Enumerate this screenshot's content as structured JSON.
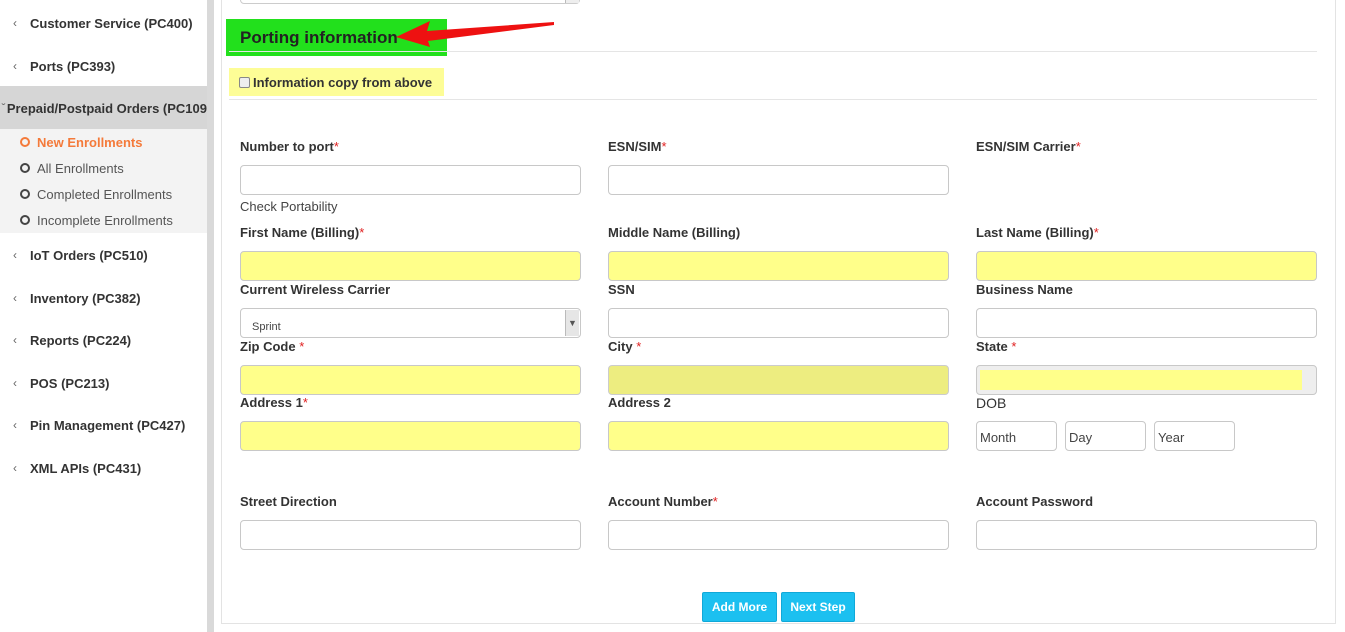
{
  "sidebar": {
    "items": [
      {
        "label": "Customer Service (PC400)"
      },
      {
        "label": "Ports (PC393)"
      },
      {
        "label": "Prepaid/Postpaid Orders (PC109"
      },
      {
        "label": "IoT Orders (PC510)"
      },
      {
        "label": "Inventory (PC382)"
      },
      {
        "label": "Reports (PC224)"
      },
      {
        "label": "POS (PC213)"
      },
      {
        "label": "Pin Management (PC427)"
      },
      {
        "label": "XML APIs (PC431)"
      }
    ],
    "submenu": [
      {
        "label": "New Enrollments",
        "active": true
      },
      {
        "label": "All Enrollments"
      },
      {
        "label": "Completed Enrollments"
      },
      {
        "label": "Incomplete Enrollments"
      }
    ],
    "active_color": "#f47a3a"
  },
  "section": {
    "title": "Porting information",
    "title_bg": "#22e01c",
    "copy_label": "Information copy from above",
    "highlight_color": "#ffff8a"
  },
  "form": {
    "number_to_port": "Number to port",
    "esn_sim": "ESN/SIM",
    "esn_sim_carrier": "ESN/SIM Carrier",
    "check_portability": "Check Portability",
    "first_name": "First Name (Billing)",
    "middle_name": "Middle Name (Billing)",
    "last_name": "Last Name (Billing)",
    "current_carrier": "Current Wireless Carrier",
    "current_carrier_value": "Sprint",
    "ssn": "SSN",
    "business_name": "Business Name",
    "zip_code": "Zip Code",
    "city": "City",
    "state": "State",
    "address1": "Address 1",
    "address2": "Address 2",
    "dob": "DOB",
    "dob_month": "Month",
    "dob_day": "Day",
    "dob_year": "Year",
    "street_direction": "Street Direction",
    "account_number": "Account Number",
    "account_password": "Account Password",
    "required_mark": "*"
  },
  "buttons": {
    "add_more": "Add More",
    "next_step": "Next Step",
    "color": "#1cc0f0"
  }
}
